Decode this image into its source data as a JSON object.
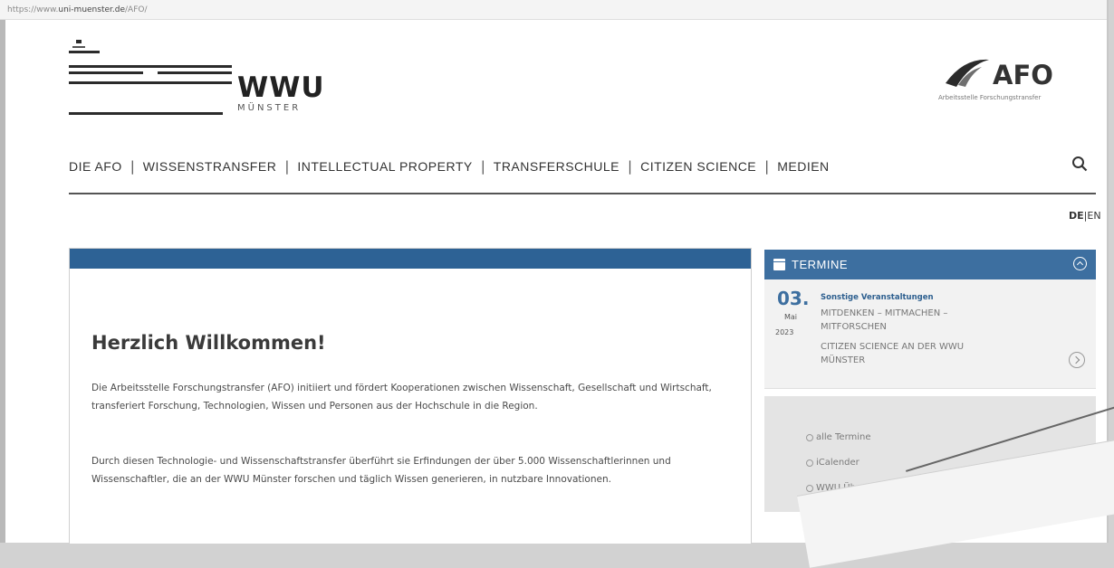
{
  "browser": {
    "url_prefix": "https://www.",
    "url_domain": "uni-muenster.de",
    "url_path": "/AFO/"
  },
  "header": {
    "wwu_logo_text": "WWU",
    "wwu_logo_sub": "MÜNSTER",
    "afo_logo_text": "AFO",
    "afo_logo_sub": "Arbeitsstelle Forschungstransfer"
  },
  "nav": {
    "items": [
      "DIE AFO",
      "WISSENSTRANSFER",
      "INTELLECTUAL PROPERTY",
      "TRANSFERSCHULE",
      "CITIZEN SCIENCE",
      "MEDIEN"
    ],
    "separator": "|",
    "search_icon": "search-icon"
  },
  "language": {
    "active": "DE",
    "separator": "|",
    "other": "EN"
  },
  "main": {
    "title": "Herzlich Willkommen!",
    "paragraph1": "Die Arbeitsstelle Forschungstransfer (AFO) initiiert und fördert Kooperationen zwischen Wissenschaft, Gesellschaft und Wirtschaft, transferiert Forschung, Technologien, Wissen und Personen aus der Hochschule in die Region.",
    "paragraph2": "Durch diesen Technologie- und Wissenschaftstransfer überführt sie Erfindungen der über 5.000 Wissenschaftlerinnen und Wissenschaftler, die an der WWU Münster forschen und täglich Wissen generieren, in nutzbare Innovationen.",
    "accent_color": "#2d6295"
  },
  "termine": {
    "title": "TERMINE",
    "event": {
      "day": "03.",
      "month": "Mai",
      "year": "2023",
      "category": "Sonstige Veranstaltungen",
      "title": "MITDENKEN – MITMACHEN – MITFORSCHEN",
      "subtitle": "CITIZEN SCIENCE AN DER WWU MÜNSTER"
    },
    "links": [
      "alle Termine",
      "iCalender",
      "WWU Überblick"
    ]
  }
}
